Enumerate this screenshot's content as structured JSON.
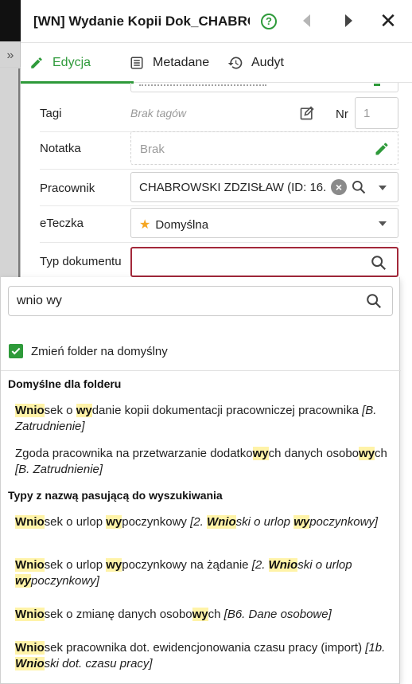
{
  "window": {
    "title": "[WN] Wydanie Kopii Dok_CHABRO...",
    "help_label": "?"
  },
  "tabs": [
    {
      "label": "Edycja",
      "active": true
    },
    {
      "label": "Metadane",
      "active": false
    },
    {
      "label": "Audyt",
      "active": false
    }
  ],
  "form": {
    "tags": {
      "label": "Tagi",
      "value": "Brak tagów"
    },
    "nr": {
      "label": "Nr",
      "value": "1"
    },
    "note": {
      "label": "Notatka",
      "placeholder": "Brak"
    },
    "employee": {
      "label": "Pracownik",
      "value": "CHABROWSKI ZDZISŁAW (ID: 16..."
    },
    "eteczka": {
      "label": "eTeczka",
      "value": "Domyślna"
    },
    "doc_type": {
      "label": "Typ dokumentu",
      "value": ""
    }
  },
  "dropdown": {
    "search_value": "wnio wy",
    "change_folder_label": "Zmień folder na domyślny",
    "change_folder_checked": true,
    "section_default": "Domyślne dla folderu",
    "section_matching": "Typy z nazwą pasującą do wyszukiwania",
    "default_items": [
      {
        "text": "Wniosek o wydanie kopii dokumentacji pracowniczej pracownika",
        "category": "[B. Zatrudnienie]"
      },
      {
        "text": "Zgoda pracownika na przetwarzanie dodatkowych danych osobowych",
        "category": "[B. Zatrudnienie]"
      }
    ],
    "matching_items": [
      {
        "text": "Wniosek o urlop wypoczynkowy",
        "category": "[2. Wnioski o urlop wypoczynkowy]"
      },
      {
        "text": "Wniosek o urlop wypoczynkowy na żądanie",
        "category": "[2. Wnioski o urlop wypoczynkowy]"
      },
      {
        "text": "Wniosek o zmianę danych osobowych",
        "category": "[B6. Dane osobowe]"
      },
      {
        "text": "Wniosek pracownika dot. ewidencjonowania czasu pracy (import)",
        "category": "[1b. Wnioski dot. czasu pracy]"
      }
    ]
  },
  "colors": {
    "accent_green": "#2e9a3a",
    "error_border": "#a3283a",
    "highlight": "#fff3a8",
    "star": "#f5a623"
  },
  "icons": [
    "help-icon",
    "prev-icon",
    "next-icon",
    "close-icon",
    "pencil-icon",
    "list-icon",
    "history-icon",
    "tag-edit-icon",
    "clear-icon",
    "search-icon",
    "star-icon",
    "caret-down-icon",
    "check-icon",
    "expand-icon"
  ]
}
